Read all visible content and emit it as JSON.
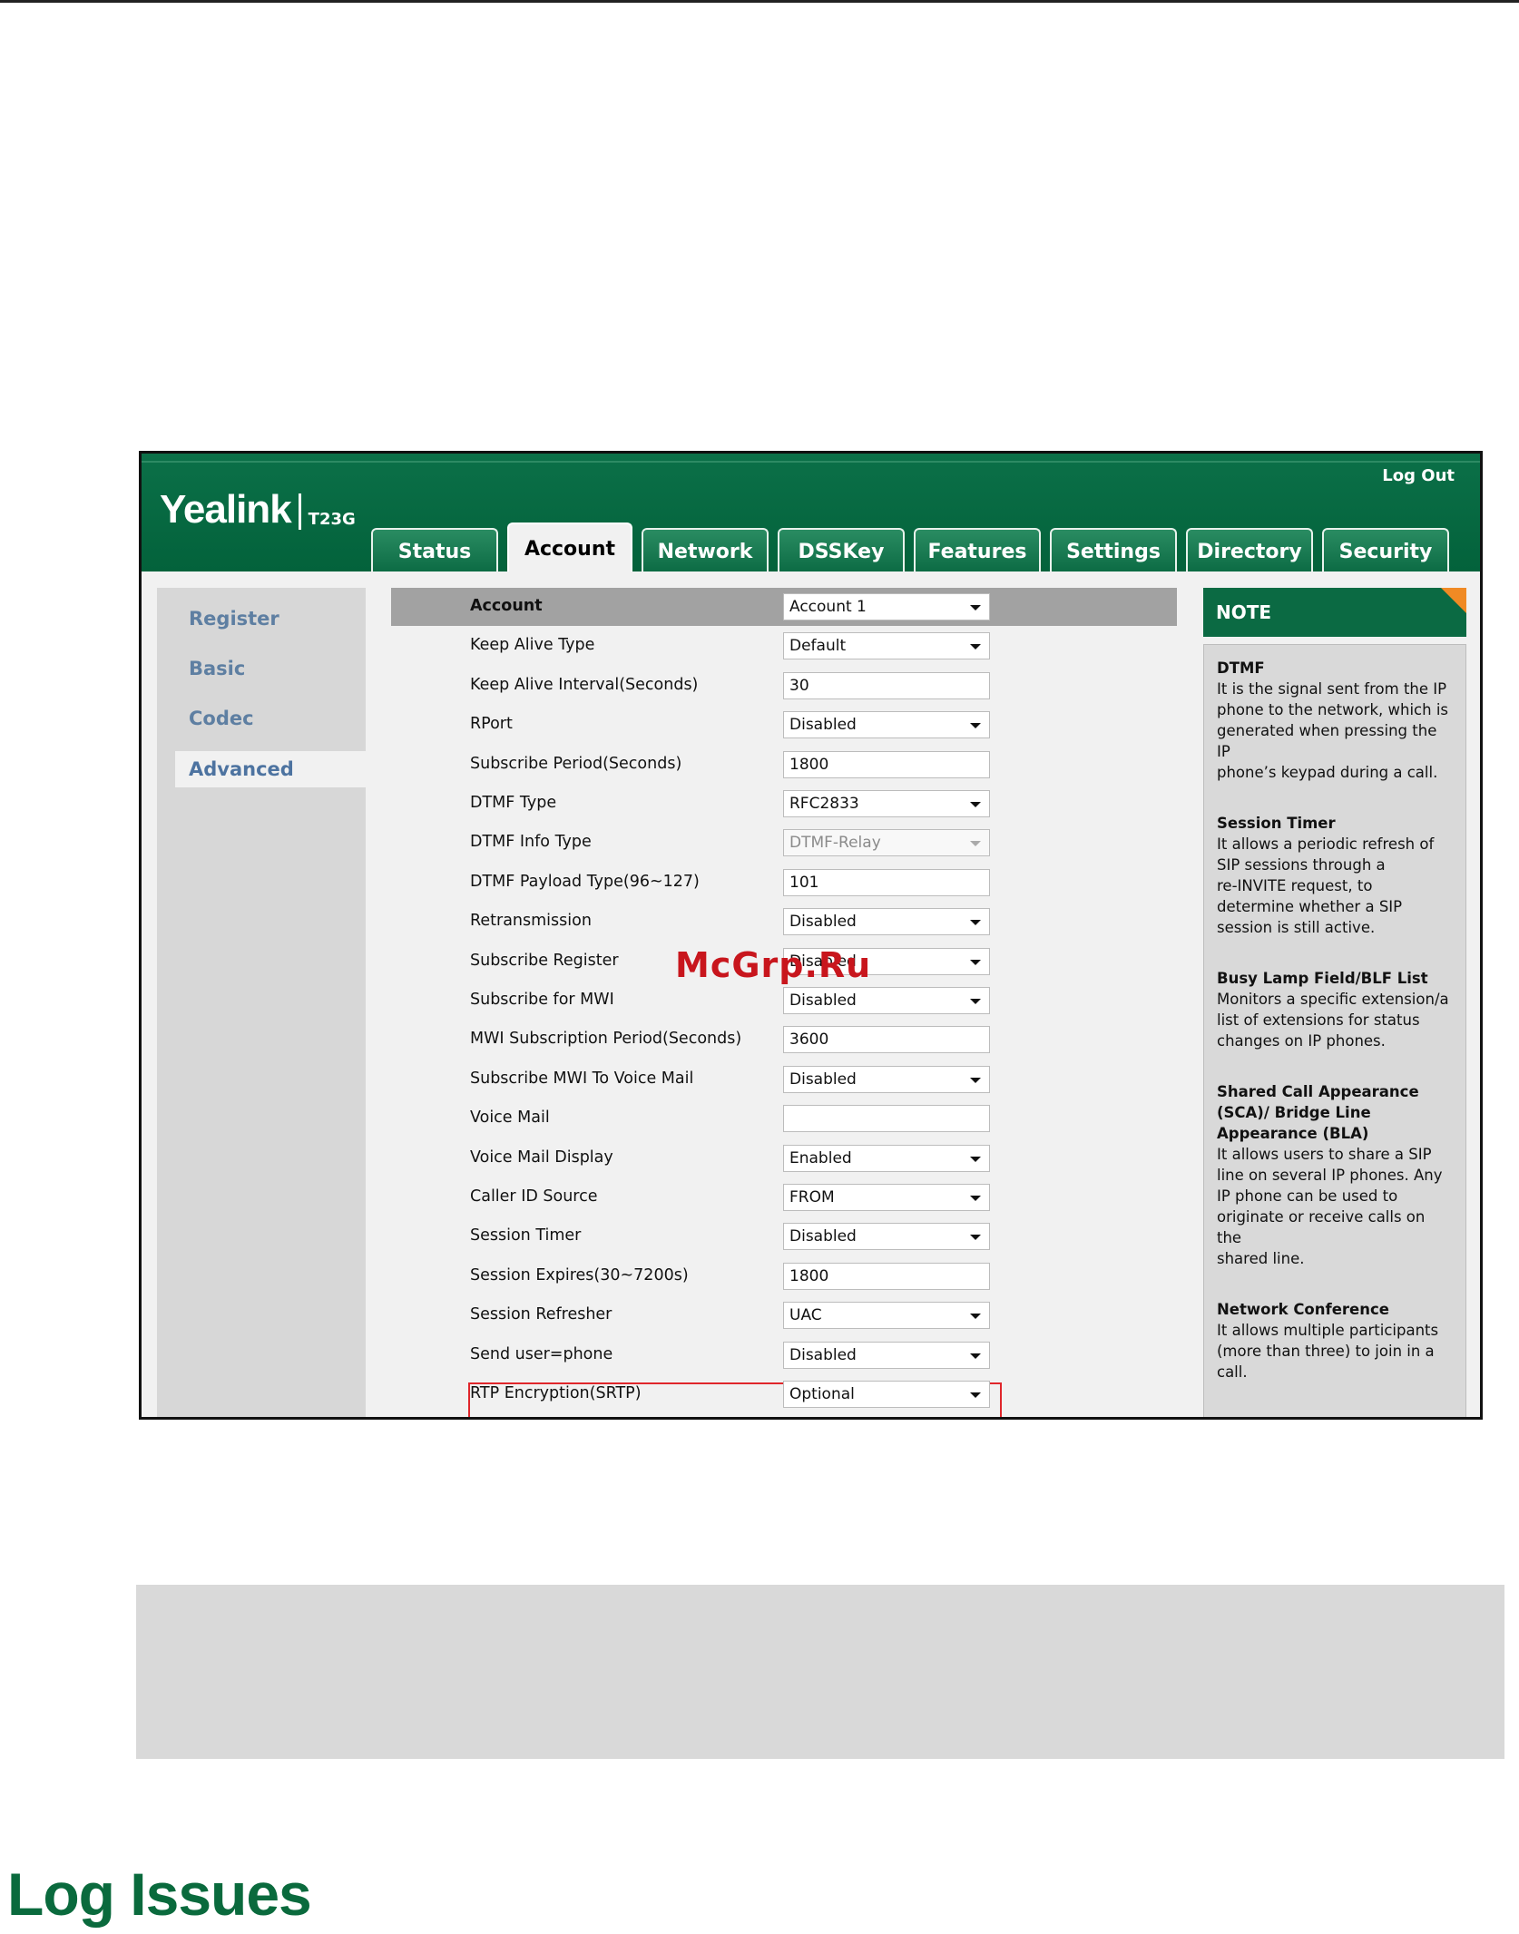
{
  "header": {
    "brand": "Yealink",
    "model": "T23G",
    "logout": "Log Out",
    "tabs": [
      "Status",
      "Account",
      "Network",
      "DSSKey",
      "Features",
      "Settings",
      "Directory",
      "Security"
    ],
    "active_tab": "Account"
  },
  "sidebar": {
    "items": [
      "Register",
      "Basic",
      "Codec",
      "Advanced"
    ],
    "active": "Advanced"
  },
  "form": {
    "rows": [
      {
        "label": "Account",
        "value": "Account 1",
        "type": "select"
      },
      {
        "label": "Keep Alive Type",
        "value": "Default",
        "type": "select"
      },
      {
        "label": "Keep Alive Interval(Seconds)",
        "value": "30",
        "type": "input"
      },
      {
        "label": "RPort",
        "value": "Disabled",
        "type": "select"
      },
      {
        "label": "Subscribe Period(Seconds)",
        "value": "1800",
        "type": "input"
      },
      {
        "label": "DTMF Type",
        "value": "RFC2833",
        "type": "select"
      },
      {
        "label": "DTMF Info Type",
        "value": "DTMF-Relay",
        "type": "select-disabled"
      },
      {
        "label": "DTMF Payload Type(96~127)",
        "value": "101",
        "type": "input"
      },
      {
        "label": "Retransmission",
        "value": "Disabled",
        "type": "select"
      },
      {
        "label": "Subscribe Register",
        "value": "Disabled",
        "type": "select"
      },
      {
        "label": "Subscribe for MWI",
        "value": "Disabled",
        "type": "select"
      },
      {
        "label": "MWI Subscription Period(Seconds)",
        "value": "3600",
        "type": "input"
      },
      {
        "label": "Subscribe MWI To Voice Mail",
        "value": "Disabled",
        "type": "select"
      },
      {
        "label": "Voice Mail",
        "value": "",
        "type": "input"
      },
      {
        "label": "Voice Mail Display",
        "value": "Enabled",
        "type": "select"
      },
      {
        "label": "Caller ID Source",
        "value": "FROM",
        "type": "select"
      },
      {
        "label": "Session Timer",
        "value": "Disabled",
        "type": "select"
      },
      {
        "label": "Session Expires(30~7200s)",
        "value": "1800",
        "type": "input"
      },
      {
        "label": "Session Refresher",
        "value": "UAC",
        "type": "select"
      },
      {
        "label": "Send user=phone",
        "value": "Disabled",
        "type": "select"
      },
      {
        "label": "RTP Encryption(SRTP)",
        "value": "Optional",
        "type": "select"
      }
    ],
    "highlighted_row": "RTP Encryption(SRTP)"
  },
  "note": {
    "title": "NOTE",
    "sections": [
      {
        "title": "DTMF",
        "lines": [
          "It is the signal sent from the IP",
          "phone to the network, which is",
          "generated when pressing the IP",
          "phone’s keypad during a call."
        ]
      },
      {
        "title": "Session Timer",
        "lines": [
          "It allows a periodic refresh of",
          "SIP sessions through a",
          "re-INVITE request, to",
          "determine whether a SIP",
          "session is still active."
        ]
      },
      {
        "title": "Busy Lamp Field/BLF List",
        "lines": [
          "Monitors a specific extension/a",
          "list of extensions for status",
          "changes on IP phones."
        ]
      },
      {
        "title_lines": [
          "Shared Call Appearance",
          "(SCA)/ Bridge Line",
          "Appearance (BLA)"
        ],
        "lines": [
          "It allows users to share a SIP",
          "line on several IP phones. Any",
          "IP phone can be used to",
          "originate or receive calls on the",
          "shared line."
        ]
      },
      {
        "title": "Network Conference",
        "lines": [
          "It allows multiple participants",
          "(more than three) to join in a",
          "call."
        ]
      }
    ]
  },
  "watermark": "McGrp.Ru",
  "page": {
    "heading": "Log Issues"
  },
  "colors": {
    "brand_green": "#0b6a43",
    "highlight_red": "#e0262b",
    "note_corner": "#f08a24",
    "heading_green": "#0a6a3d"
  }
}
